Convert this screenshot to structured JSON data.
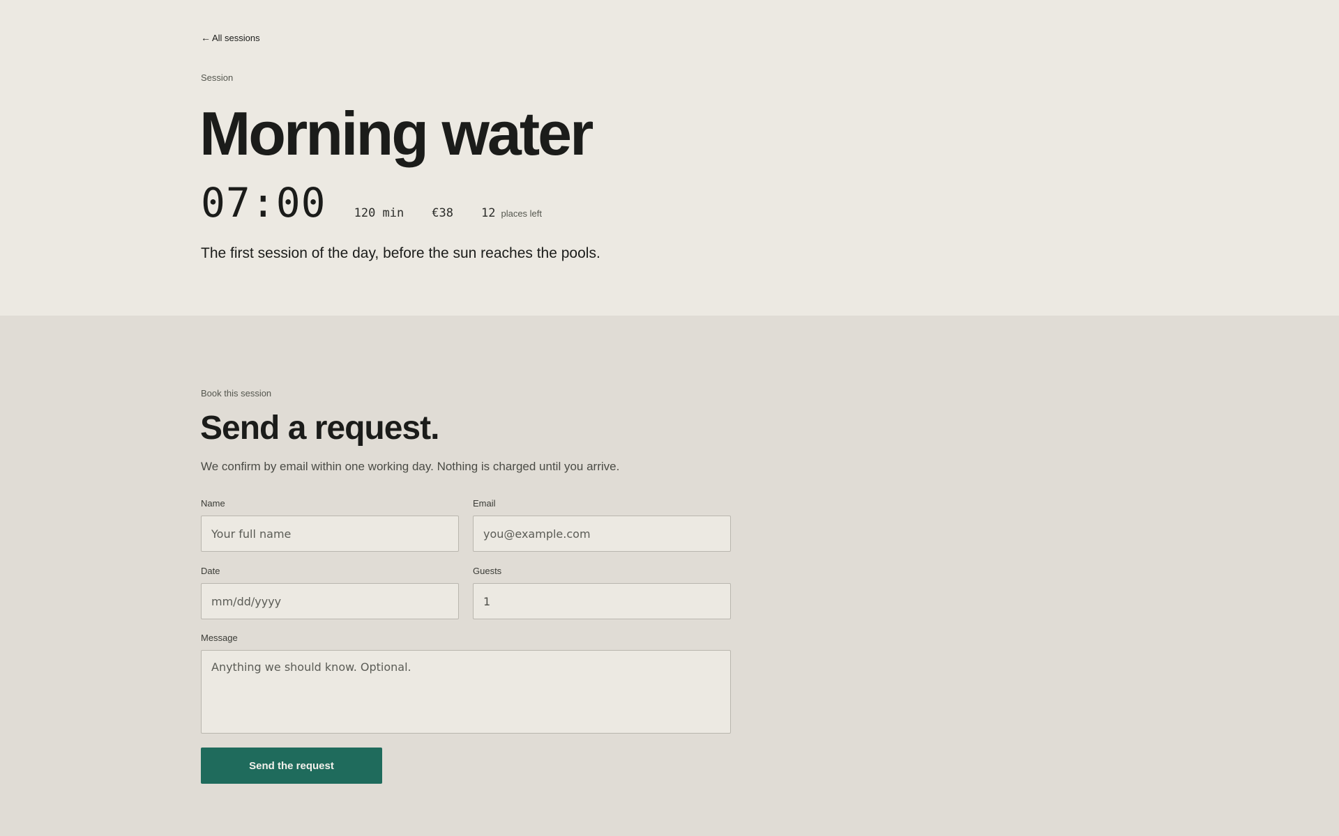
{
  "nav": {
    "back_arrow": "←",
    "back_label": "All sessions"
  },
  "session": {
    "eyebrow": "Session",
    "title": "Morning water",
    "time": "07:00",
    "duration": "120 min",
    "price": "€38",
    "places_count": "12",
    "places_label": "places left",
    "description": "The first session of the day, before the sun reaches the pools."
  },
  "booking": {
    "eyebrow": "Book this session",
    "title": "Send a request.",
    "intro": "We confirm by email within one working day. Nothing is charged until you arrive.",
    "fields": {
      "name": {
        "label": "Name",
        "placeholder": "Your full name"
      },
      "email": {
        "label": "Email",
        "placeholder": "you@example.com"
      },
      "date": {
        "label": "Date",
        "placeholder": "mm/dd/yyyy"
      },
      "guests": {
        "label": "Guests",
        "value": "1"
      },
      "message": {
        "label": "Message",
        "placeholder": "Anything we should know. Optional."
      }
    },
    "submit_label": "Send the request"
  },
  "colors": {
    "hero_background": "#ece9e2",
    "form_background": "#e0dcd5",
    "accent": "#1f6b5c",
    "text": "#1b1c1a"
  }
}
